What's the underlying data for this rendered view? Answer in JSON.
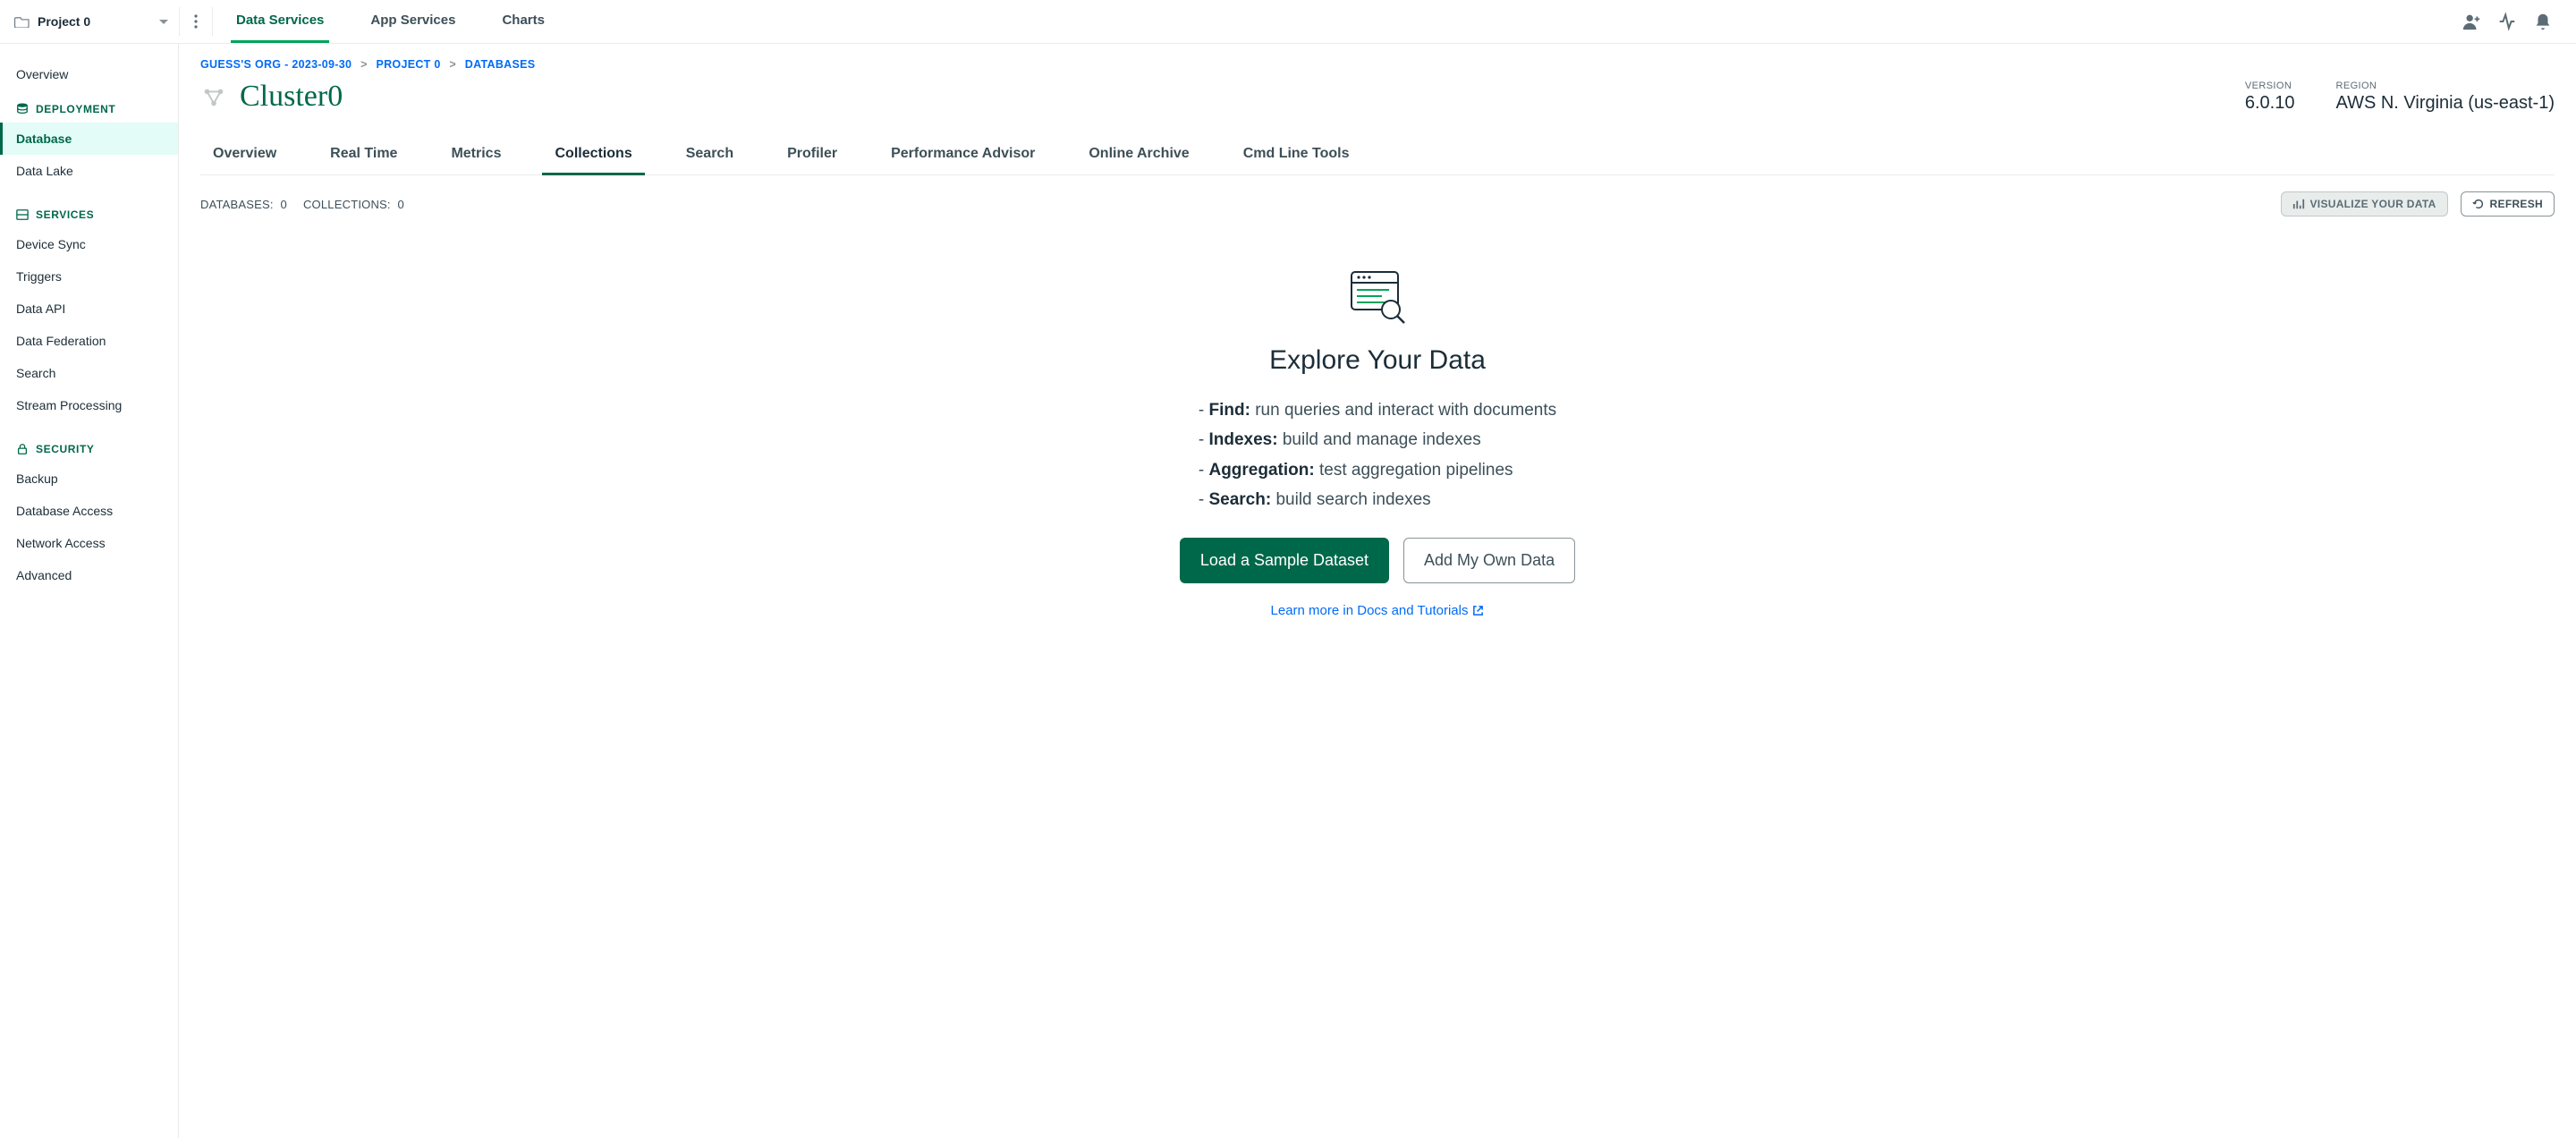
{
  "topnav": {
    "project_name": "Project 0",
    "tabs": [
      {
        "label": "Data Services",
        "active": true
      },
      {
        "label": "App Services"
      },
      {
        "label": "Charts"
      }
    ]
  },
  "sidebar": {
    "overview": "Overview",
    "sections": [
      {
        "header": "DEPLOYMENT",
        "icon": "database-stack",
        "items": [
          {
            "label": "Database",
            "active": true
          },
          {
            "label": "Data Lake"
          }
        ]
      },
      {
        "header": "SERVICES",
        "icon": "server",
        "items": [
          {
            "label": "Device Sync"
          },
          {
            "label": "Triggers"
          },
          {
            "label": "Data API"
          },
          {
            "label": "Data Federation"
          },
          {
            "label": "Search"
          },
          {
            "label": "Stream Processing"
          }
        ]
      },
      {
        "header": "SECURITY",
        "icon": "lock",
        "items": [
          {
            "label": "Backup"
          },
          {
            "label": "Database Access"
          },
          {
            "label": "Network Access"
          },
          {
            "label": "Advanced"
          }
        ]
      }
    ]
  },
  "breadcrumb": {
    "org": "GUESS'S ORG - 2023-09-30",
    "project": "PROJECT 0",
    "current": "DATABASES"
  },
  "cluster": {
    "name": "Cluster0",
    "version_label": "VERSION",
    "version": "6.0.10",
    "region_label": "REGION",
    "region": "AWS N. Virginia (us-east-1)"
  },
  "subtabs": [
    {
      "label": "Overview"
    },
    {
      "label": "Real Time"
    },
    {
      "label": "Metrics"
    },
    {
      "label": "Collections",
      "active": true
    },
    {
      "label": "Search"
    },
    {
      "label": "Profiler"
    },
    {
      "label": "Performance Advisor"
    },
    {
      "label": "Online Archive"
    },
    {
      "label": "Cmd Line Tools"
    }
  ],
  "stats": {
    "databases_label": "DATABASES:",
    "databases_count": "0",
    "collections_label": "COLLECTIONS:",
    "collections_count": "0",
    "visualize_btn": "VISUALIZE YOUR DATA",
    "refresh_btn": "REFRESH"
  },
  "empty": {
    "title": "Explore Your Data",
    "features": [
      {
        "name": "Find:",
        "desc": "run queries and interact with documents"
      },
      {
        "name": "Indexes:",
        "desc": "build and manage indexes"
      },
      {
        "name": "Aggregation:",
        "desc": "test aggregation pipelines"
      },
      {
        "name": "Search:",
        "desc": "build search indexes"
      }
    ],
    "primary_btn": "Load a Sample Dataset",
    "secondary_btn": "Add My Own Data",
    "learn_more": "Learn more in Docs and Tutorials"
  }
}
